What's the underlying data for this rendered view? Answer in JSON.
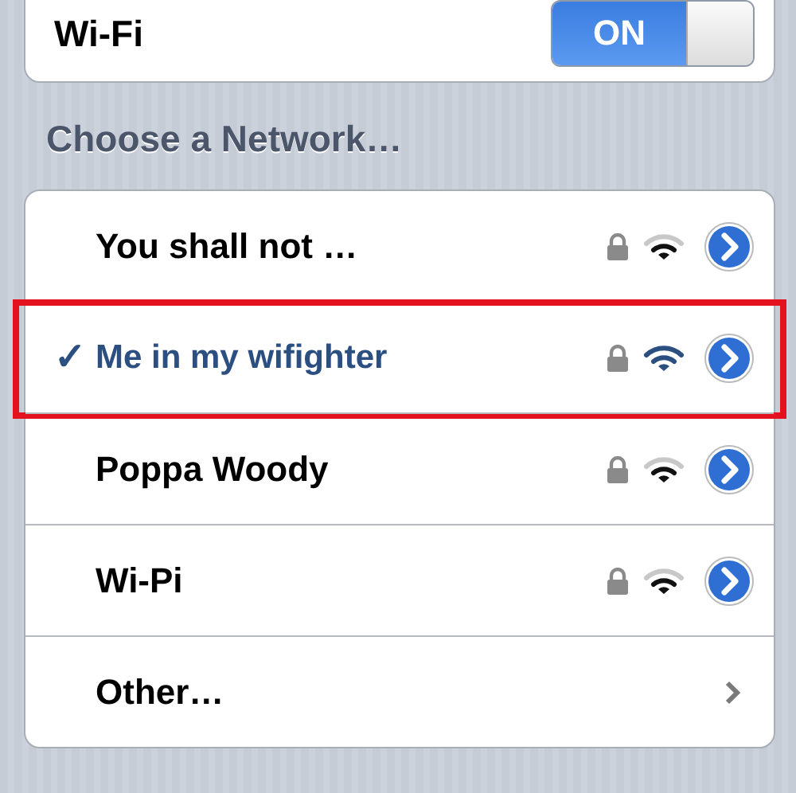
{
  "wifi": {
    "label": "Wi-Fi",
    "on": true,
    "on_text": "ON"
  },
  "section_header": "Choose a Network…",
  "networks": [
    {
      "name": "You shall not …",
      "selected": false,
      "highlighted": false,
      "locked": true
    },
    {
      "name": "Me in my wifighter",
      "selected": true,
      "highlighted": true,
      "locked": true
    },
    {
      "name": "Poppa Woody",
      "selected": false,
      "highlighted": false,
      "locked": true
    },
    {
      "name": "Wi-Pi",
      "selected": false,
      "highlighted": false,
      "locked": true
    }
  ],
  "other": {
    "label": "Other…"
  },
  "checkmark": "✓"
}
